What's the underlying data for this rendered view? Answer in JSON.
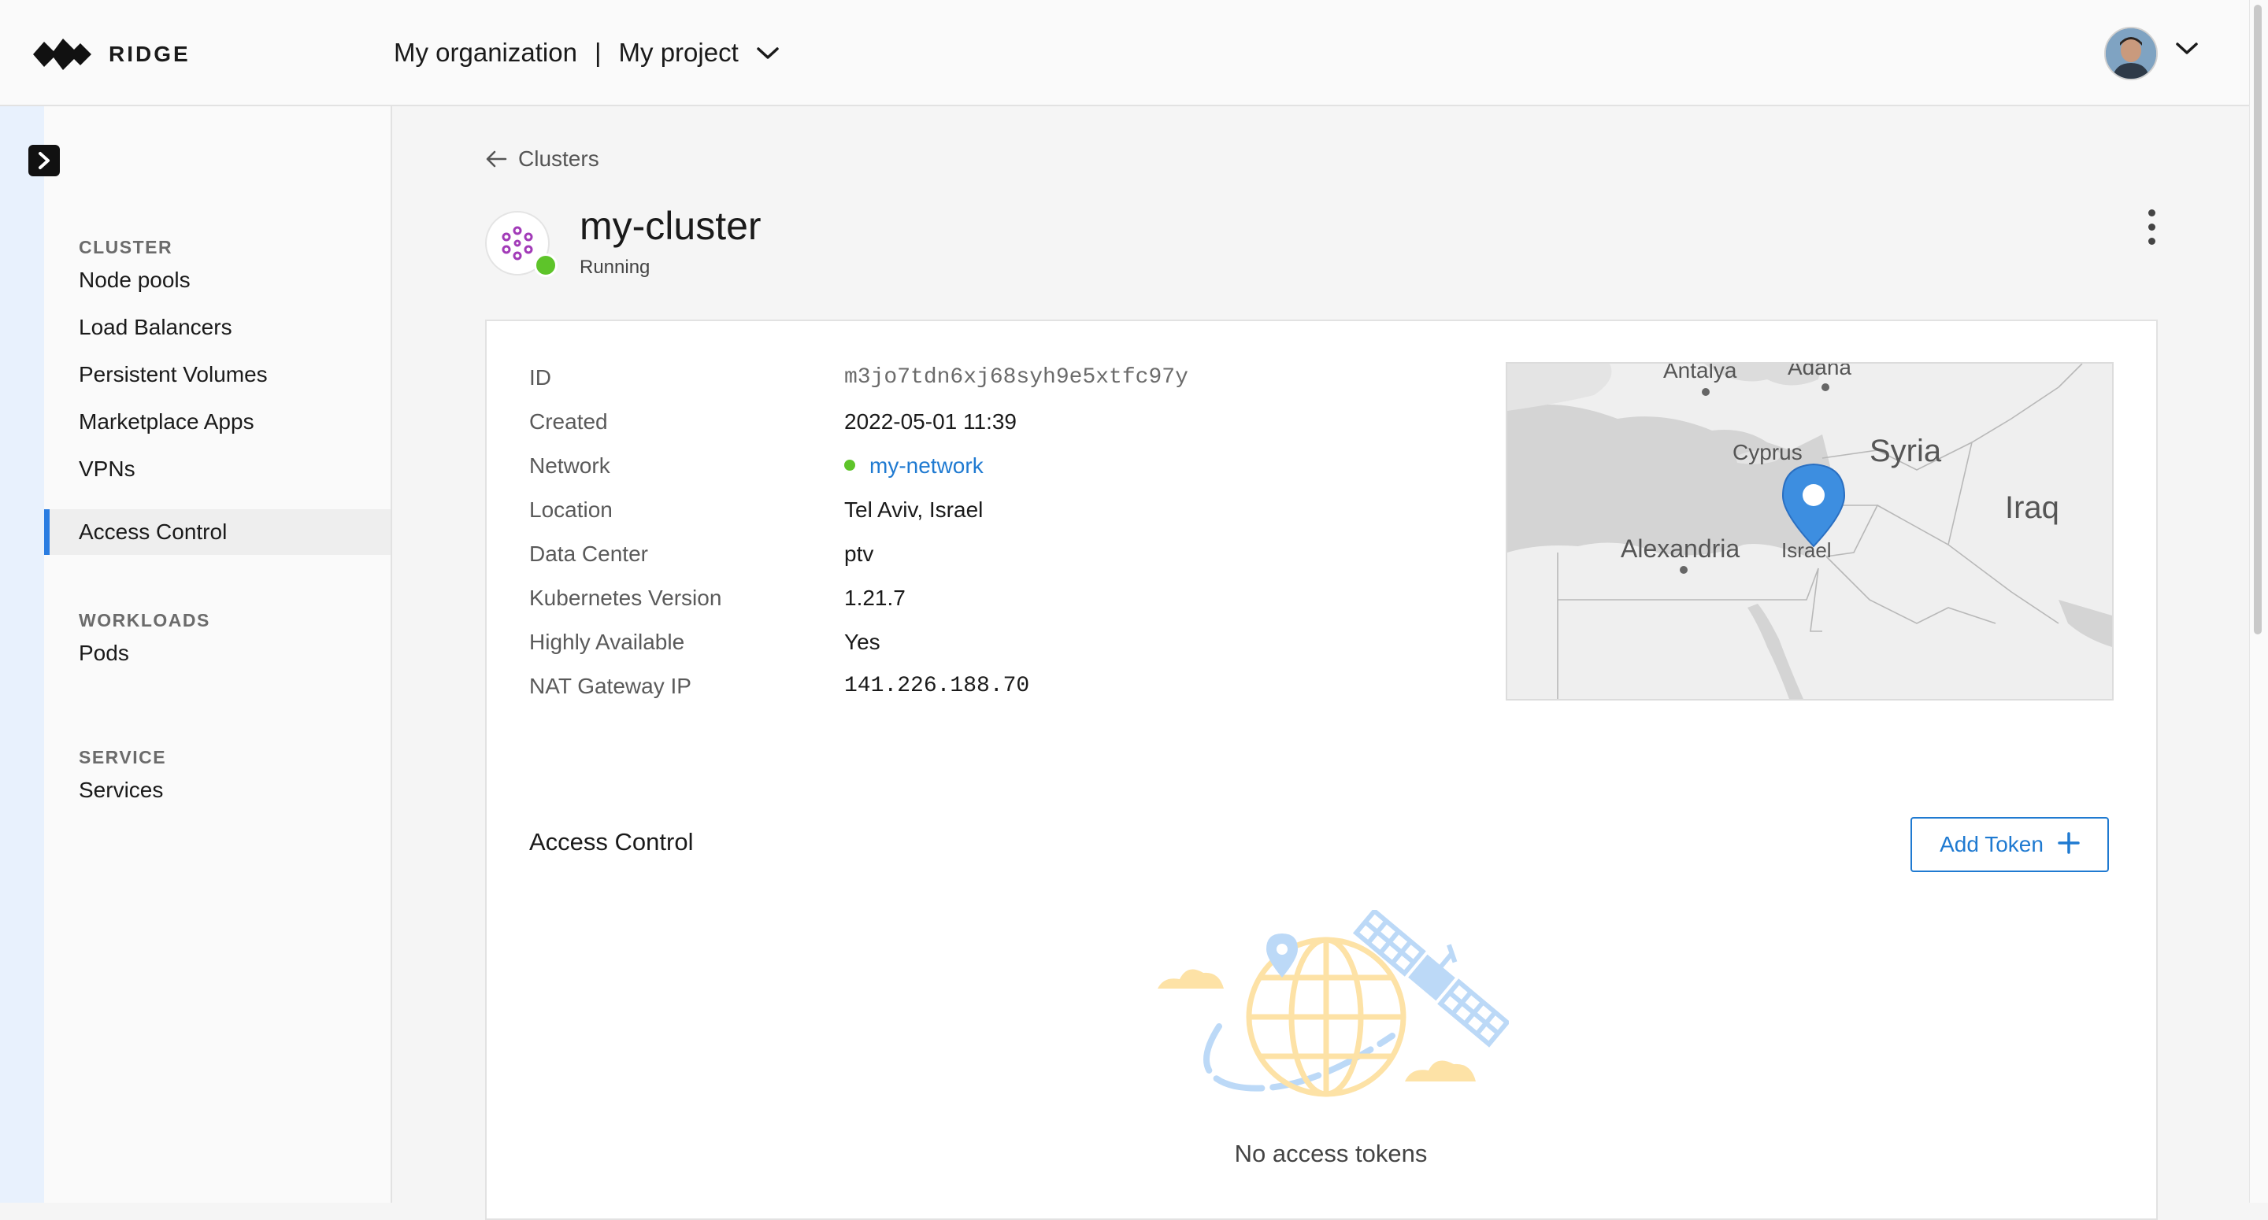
{
  "header": {
    "brand": "RIDGE",
    "organization": "My organization",
    "separator": "|",
    "project": "My project"
  },
  "sidebar": {
    "sections": [
      {
        "title": "CLUSTER",
        "items": [
          "Node pools",
          "Load Balancers",
          "Persistent Volumes",
          "Marketplace Apps",
          "VPNs",
          "Access Control"
        ]
      },
      {
        "title": "WORKLOADS",
        "items": [
          "Pods"
        ]
      },
      {
        "title": "SERVICE",
        "items": [
          "Services"
        ]
      }
    ],
    "active_item": "Access Control"
  },
  "back_link": "Clusters",
  "cluster": {
    "name": "my-cluster",
    "status": "Running",
    "status_color": "#5ec42a"
  },
  "details": [
    {
      "label": "ID",
      "value": "m3jo7tdn6xj68syh9e5xtfc97y"
    },
    {
      "label": "Created",
      "value": "2022-05-01 11:39"
    },
    {
      "label": "Network",
      "value": "my-network"
    },
    {
      "label": "Location",
      "value": "Tel Aviv, Israel"
    },
    {
      "label": "Data Center",
      "value": "ptv"
    },
    {
      "label": "Kubernetes Version",
      "value": "1.21.7"
    },
    {
      "label": "Highly Available",
      "value": "Yes"
    },
    {
      "label": "NAT Gateway IP",
      "value": "141.226.188.70"
    }
  ],
  "map": {
    "labels": [
      "Antalya",
      "Adana",
      "Cyprus",
      "Syria",
      "Iraq",
      "Alexandria",
      "Israel"
    ],
    "pin_color": "#3d8ee0"
  },
  "access_control": {
    "title": "Access Control",
    "add_button": "Add Token",
    "empty_text": "No access tokens"
  },
  "colors": {
    "accent": "#1f7ad1",
    "active_bar": "#2a7de1"
  }
}
